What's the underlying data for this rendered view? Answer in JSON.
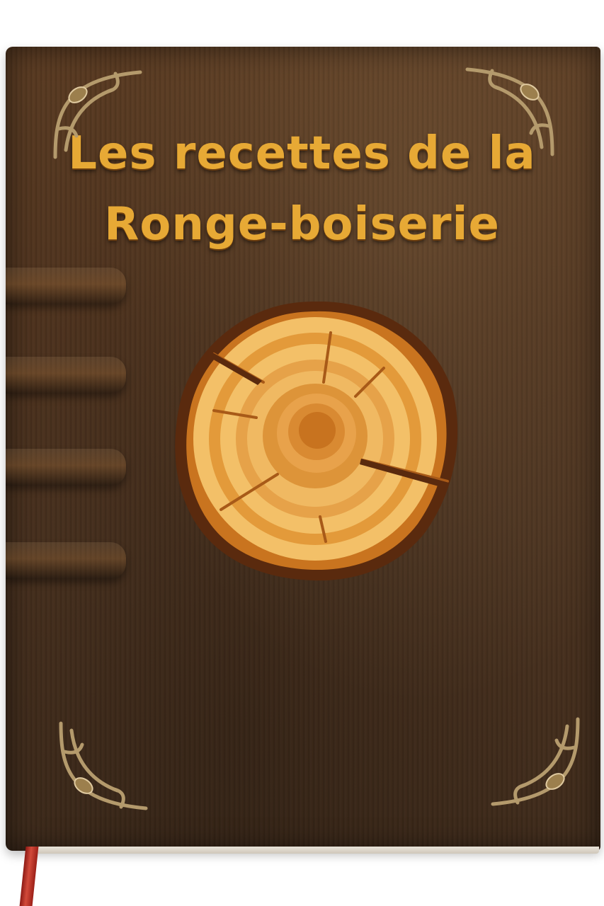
{
  "cover": {
    "title_line_1": "Les recettes de la",
    "title_line_2": "Ronge-boiserie"
  },
  "colors": {
    "leather": "#4e331e",
    "title_gold": "#e7a935",
    "wood_light": "#f3c068",
    "wood_mid": "#e39a3a",
    "wood_dark": "#b86a1e",
    "bark": "#5a2a0e",
    "ribbon": "#c23a2c",
    "brass": "#a8916a"
  },
  "icons": {
    "corner_ornament": "ornate-brass-corner-icon",
    "tree_slice": "tree-ring-slice-icon",
    "bookmark": "ribbon-bookmark-icon"
  }
}
